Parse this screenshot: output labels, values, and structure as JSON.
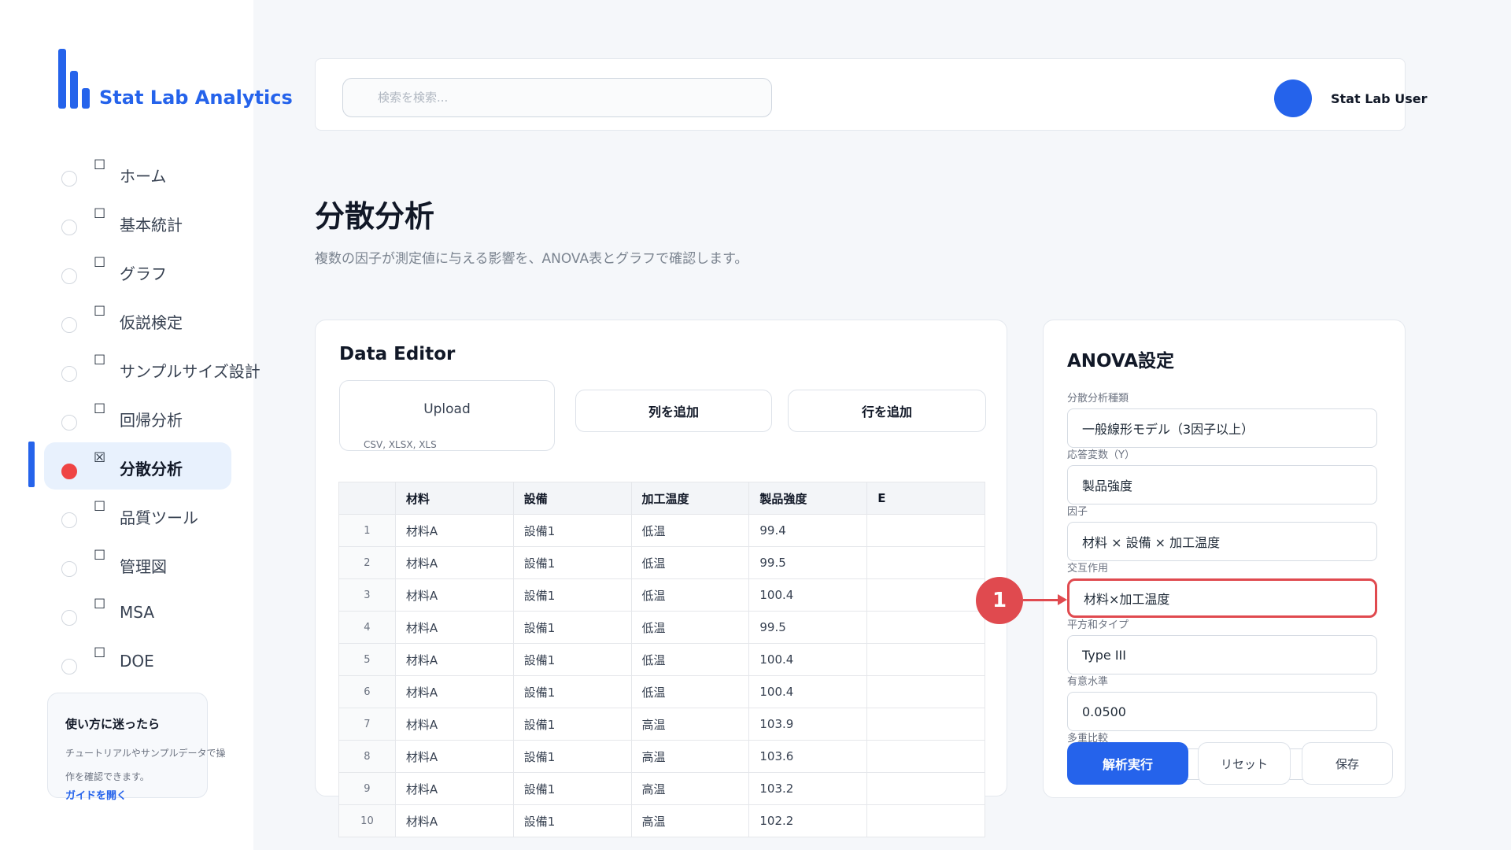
{
  "brand": {
    "name": "Stat Lab Analytics"
  },
  "search": {
    "placeholder": "検索を検索..."
  },
  "user": {
    "name": "Stat Lab User"
  },
  "sidebar": {
    "items": [
      {
        "label": "ホーム",
        "box": "☐"
      },
      {
        "label": "基本統計",
        "box": "☐"
      },
      {
        "label": "グラフ",
        "box": "☐"
      },
      {
        "label": "仮説検定",
        "box": "☐"
      },
      {
        "label": "サンプルサイズ設計",
        "box": "☐"
      },
      {
        "label": "回帰分析",
        "box": "☐"
      },
      {
        "label": "分散分析",
        "box": "☒"
      },
      {
        "label": "品質ツール",
        "box": "☐"
      },
      {
        "label": "管理図",
        "box": "☐"
      },
      {
        "label": "MSA",
        "box": "☐"
      },
      {
        "label": "DOE",
        "box": "☐"
      }
    ],
    "active_index": 6,
    "help": {
      "title": "使い方に迷ったら",
      "text": "チュートリアルやサンプルデータで操作を確認できます。",
      "link": "ガイドを開く"
    }
  },
  "page": {
    "title": "分散分析",
    "subtitle": "複数の因子が測定値に与える影響を、ANOVA表とグラフで確認します。"
  },
  "editor": {
    "title": "Data Editor",
    "upload_label": "Upload",
    "upload_hint": "CSV, XLSX, XLS",
    "add_column": "列を追加",
    "add_row": "行を追加",
    "table": {
      "columns": [
        "",
        "材料",
        "設備",
        "加工温度",
        "製品強度",
        "E"
      ],
      "rows": [
        [
          "1",
          "材料A",
          "設備1",
          "低温",
          "99.4",
          ""
        ],
        [
          "2",
          "材料A",
          "設備1",
          "低温",
          "99.5",
          ""
        ],
        [
          "3",
          "材料A",
          "設備1",
          "低温",
          "100.4",
          ""
        ],
        [
          "4",
          "材料A",
          "設備1",
          "低温",
          "99.5",
          ""
        ],
        [
          "5",
          "材料A",
          "設備1",
          "低温",
          "100.4",
          ""
        ],
        [
          "6",
          "材料A",
          "設備1",
          "低温",
          "100.4",
          ""
        ],
        [
          "7",
          "材料A",
          "設備1",
          "高温",
          "103.9",
          ""
        ],
        [
          "8",
          "材料A",
          "設備1",
          "高温",
          "103.6",
          ""
        ],
        [
          "9",
          "材料A",
          "設備1",
          "高温",
          "103.2",
          ""
        ],
        [
          "10",
          "材料A",
          "設備1",
          "高温",
          "102.2",
          ""
        ]
      ]
    }
  },
  "anova": {
    "title": "ANOVA設定",
    "fields": [
      {
        "label": "分散分析種類",
        "value": "一般線形モデル（3因子以上）"
      },
      {
        "label": "応答変数（Y）",
        "value": "製品強度"
      },
      {
        "label": "因子",
        "value": "材料 × 設備 × 加工温度"
      },
      {
        "label": "交互作用",
        "value": "材料×加工温度"
      },
      {
        "label": "平方和タイプ",
        "value": "Type III"
      },
      {
        "label": "有意水準",
        "value": "0.0500"
      },
      {
        "label": "多重比較",
        "value": ""
      }
    ],
    "run": "解析実行",
    "reset": "リセット",
    "save": "保存"
  },
  "annotation": {
    "number": "1",
    "color": "#e04a4f"
  },
  "colors": {
    "accent": "#2563eb",
    "active_bg": "#e8f1fd",
    "active_dot": "#ef4444"
  }
}
